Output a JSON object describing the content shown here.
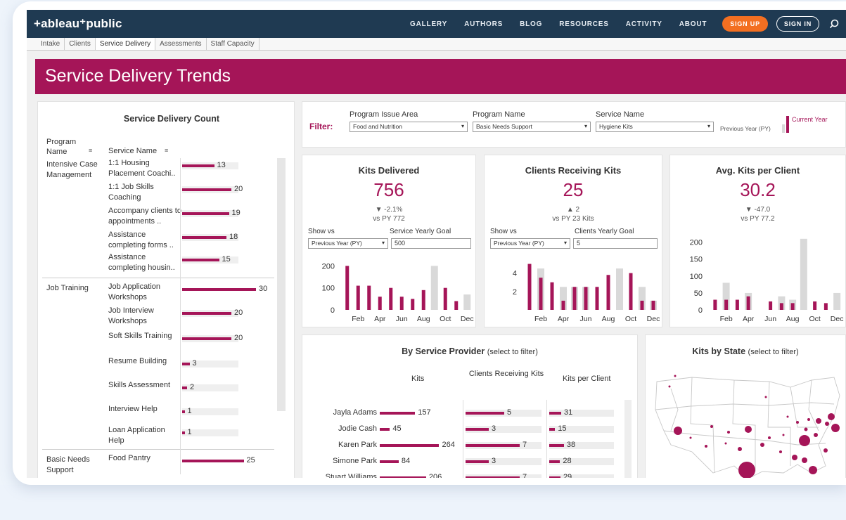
{
  "nav": {
    "logo": "+ableau⁺public",
    "links": [
      "GALLERY",
      "AUTHORS",
      "BLOG",
      "RESOURCES",
      "ACTIVITY",
      "ABOUT"
    ],
    "signup": "SIGN UP",
    "signin": "SIGN IN"
  },
  "tabs": [
    "Intake",
    "Clients",
    "Service Delivery",
    "Assessments",
    "Staff Capacity"
  ],
  "active_tab": "Service Delivery",
  "banner": {
    "title": "Service Delivery Trends"
  },
  "sdcount": {
    "title": "Service Delivery Count",
    "col_program": "Program Name",
    "col_service": "Service Name",
    "rows": [
      {
        "program": "Intensive Case Management",
        "service": "1:1 Housing Placement Coachi..",
        "value": 13
      },
      {
        "program": "",
        "service": "1:1 Job Skills Coaching",
        "value": 20
      },
      {
        "program": "",
        "service": "Accompany clients to appointments ..",
        "value": 19
      },
      {
        "program": "",
        "service": "Assistance completing forms ..",
        "value": 18
      },
      {
        "program": "",
        "service": "Assistance completing housin..",
        "value": 15
      },
      {
        "program": "Job Training",
        "service": "Job Application Workshops",
        "value": 30
      },
      {
        "program": "",
        "service": "Job Interview Workshops",
        "value": 20
      },
      {
        "program": "",
        "service": "Soft Skills Training",
        "value": 20
      },
      {
        "program": "",
        "service": "Resume Building",
        "value": 3
      },
      {
        "program": "",
        "service": "Skills Assessment",
        "value": 2
      },
      {
        "program": "",
        "service": "Interview Help",
        "value": 1
      },
      {
        "program": "",
        "service": "Loan Application Help",
        "value": 1
      },
      {
        "program": "Basic Needs Support",
        "service": "Food Pantry",
        "value": 25
      }
    ]
  },
  "filter": {
    "label": "Filter:",
    "program_issue_label": "Program Issue Area",
    "program_issue_value": "Food and Nutrition",
    "program_name_label": "Program Name",
    "program_name_value": "Basic Needs Support",
    "service_name_label": "Service Name",
    "service_name_value": "Hygiene Kits",
    "legend_py": "Previous Year (PY)",
    "legend_cy": "Current Year"
  },
  "kpi1": {
    "title": "Kits Delivered",
    "value": "756",
    "delta": "▼ -2.1%",
    "py": "vs PY 772",
    "showvs_label": "Show vs",
    "goal_label": "Service Yearly Goal",
    "showvs_value": "Previous Year (PY)",
    "goal_value": "500"
  },
  "kpi2": {
    "title": "Clients Receiving Kits",
    "value": "25",
    "delta": "▲ 2",
    "py": "vs PY 23 Kits",
    "showvs_label": "Show vs",
    "goal_label": "Clients Yearly Goal",
    "showvs_value": "Previous Year (PY)",
    "goal_value": "5"
  },
  "kpi3": {
    "title": "Avg. Kits per Client",
    "value": "30.2",
    "delta": "▼ -47.0",
    "py": "vs PY 77.2"
  },
  "provider": {
    "title": "By Service Provider",
    "title_note": "(select to filter)",
    "col_kits": "Kits",
    "col_clients": "Clients Receiving Kits",
    "col_kpc": "Kits per Client",
    "rows": [
      {
        "name": "Jayla Adams",
        "kits": 157,
        "clients": 5,
        "kpc": 31
      },
      {
        "name": "Jodie Cash",
        "kits": 45,
        "clients": 3,
        "kpc": 15
      },
      {
        "name": "Karen Park",
        "kits": 264,
        "clients": 7,
        "kpc": 38
      },
      {
        "name": "Simone Park",
        "kits": 84,
        "clients": 3,
        "kpc": 28
      },
      {
        "name": "Stuart Williams",
        "kits": 206,
        "clients": 7,
        "kpc": 29
      }
    ]
  },
  "map": {
    "title": "Kits by State",
    "title_note": "(select to filter)"
  },
  "colors": {
    "accent": "#a51558",
    "nav": "#1f3a52",
    "signup": "#f36f21",
    "py_bar": "#d9d9d9"
  },
  "chart_data": [
    {
      "type": "bar",
      "title": "Kits Delivered",
      "categories": [
        "Jan",
        "Feb",
        "Mar",
        "Apr",
        "May",
        "Jun",
        "Jul",
        "Aug",
        "Sep",
        "Oct",
        "Nov",
        "Dec"
      ],
      "tick_labels": [
        "Feb",
        "Apr",
        "Jun",
        "Aug",
        "Oct",
        "Dec"
      ],
      "series": [
        {
          "name": "Current Year",
          "values": [
            200,
            110,
            110,
            60,
            100,
            60,
            50,
            90,
            0,
            100,
            40,
            0
          ]
        },
        {
          "name": "Previous Year (PY)",
          "values": [
            0,
            0,
            0,
            0,
            0,
            0,
            0,
            0,
            200,
            0,
            0,
            70
          ]
        }
      ],
      "yticks": [
        0,
        100,
        200
      ],
      "ylim": [
        0,
        230
      ]
    },
    {
      "type": "bar",
      "title": "Clients Receiving Kits",
      "categories": [
        "Jan",
        "Feb",
        "Mar",
        "Apr",
        "May",
        "Jun",
        "Jul",
        "Aug",
        "Sep",
        "Oct",
        "Nov",
        "Dec"
      ],
      "tick_labels": [
        "Feb",
        "Apr",
        "Jun",
        "Aug",
        "Oct",
        "Dec"
      ],
      "series": [
        {
          "name": "Current Year",
          "values": [
            5,
            3.5,
            3,
            1,
            2.5,
            2.5,
            2.5,
            3.8,
            0,
            4,
            1,
            1
          ]
        },
        {
          "name": "Previous Year (PY)",
          "values": [
            0,
            4.5,
            0,
            2.5,
            2.5,
            2.5,
            0,
            0,
            4.5,
            0,
            2.5,
            1
          ]
        }
      ],
      "yticks": [
        2,
        4
      ],
      "ylim": [
        0,
        5.5
      ]
    },
    {
      "type": "bar",
      "title": "Avg. Kits per Client",
      "categories": [
        "Jan",
        "Feb",
        "Mar",
        "Apr",
        "May",
        "Jun",
        "Jul",
        "Aug",
        "Sep",
        "Oct",
        "Nov",
        "Dec"
      ],
      "tick_labels": [
        "Feb",
        "Apr",
        "Jun",
        "Aug",
        "Oct",
        "Dec"
      ],
      "series": [
        {
          "name": "Current Year",
          "values": [
            30,
            30,
            30,
            40,
            0,
            25,
            20,
            20,
            0,
            25,
            20,
            0
          ]
        },
        {
          "name": "Previous Year (PY)",
          "values": [
            0,
            80,
            0,
            50,
            0,
            0,
            40,
            30,
            210,
            0,
            0,
            50
          ]
        }
      ],
      "yticks": [
        0,
        50,
        100,
        150,
        200
      ],
      "ylim": [
        0,
        220
      ]
    }
  ]
}
